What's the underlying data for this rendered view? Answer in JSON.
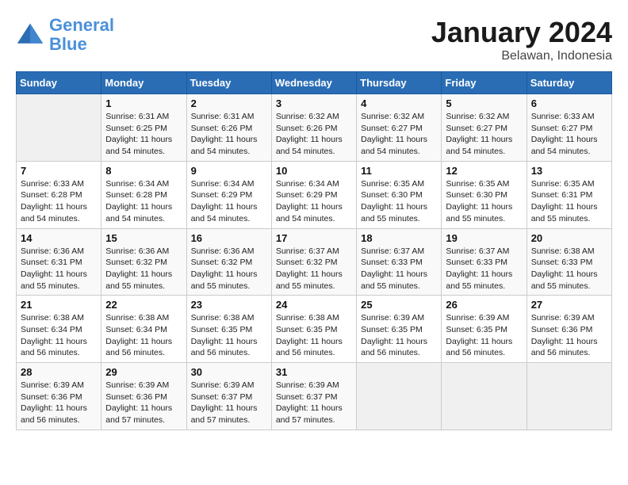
{
  "header": {
    "logo_line1": "General",
    "logo_line2": "Blue",
    "month": "January 2024",
    "location": "Belawan, Indonesia"
  },
  "days_of_week": [
    "Sunday",
    "Monday",
    "Tuesday",
    "Wednesday",
    "Thursday",
    "Friday",
    "Saturday"
  ],
  "weeks": [
    [
      {
        "day": "",
        "sunrise": "",
        "sunset": "",
        "daylight": ""
      },
      {
        "day": "1",
        "sunrise": "Sunrise: 6:31 AM",
        "sunset": "Sunset: 6:25 PM",
        "daylight": "Daylight: 11 hours and 54 minutes."
      },
      {
        "day": "2",
        "sunrise": "Sunrise: 6:31 AM",
        "sunset": "Sunset: 6:26 PM",
        "daylight": "Daylight: 11 hours and 54 minutes."
      },
      {
        "day": "3",
        "sunrise": "Sunrise: 6:32 AM",
        "sunset": "Sunset: 6:26 PM",
        "daylight": "Daylight: 11 hours and 54 minutes."
      },
      {
        "day": "4",
        "sunrise": "Sunrise: 6:32 AM",
        "sunset": "Sunset: 6:27 PM",
        "daylight": "Daylight: 11 hours and 54 minutes."
      },
      {
        "day": "5",
        "sunrise": "Sunrise: 6:32 AM",
        "sunset": "Sunset: 6:27 PM",
        "daylight": "Daylight: 11 hours and 54 minutes."
      },
      {
        "day": "6",
        "sunrise": "Sunrise: 6:33 AM",
        "sunset": "Sunset: 6:27 PM",
        "daylight": "Daylight: 11 hours and 54 minutes."
      }
    ],
    [
      {
        "day": "7",
        "sunrise": "Sunrise: 6:33 AM",
        "sunset": "Sunset: 6:28 PM",
        "daylight": "Daylight: 11 hours and 54 minutes."
      },
      {
        "day": "8",
        "sunrise": "Sunrise: 6:34 AM",
        "sunset": "Sunset: 6:28 PM",
        "daylight": "Daylight: 11 hours and 54 minutes."
      },
      {
        "day": "9",
        "sunrise": "Sunrise: 6:34 AM",
        "sunset": "Sunset: 6:29 PM",
        "daylight": "Daylight: 11 hours and 54 minutes."
      },
      {
        "day": "10",
        "sunrise": "Sunrise: 6:34 AM",
        "sunset": "Sunset: 6:29 PM",
        "daylight": "Daylight: 11 hours and 54 minutes."
      },
      {
        "day": "11",
        "sunrise": "Sunrise: 6:35 AM",
        "sunset": "Sunset: 6:30 PM",
        "daylight": "Daylight: 11 hours and 55 minutes."
      },
      {
        "day": "12",
        "sunrise": "Sunrise: 6:35 AM",
        "sunset": "Sunset: 6:30 PM",
        "daylight": "Daylight: 11 hours and 55 minutes."
      },
      {
        "day": "13",
        "sunrise": "Sunrise: 6:35 AM",
        "sunset": "Sunset: 6:31 PM",
        "daylight": "Daylight: 11 hours and 55 minutes."
      }
    ],
    [
      {
        "day": "14",
        "sunrise": "Sunrise: 6:36 AM",
        "sunset": "Sunset: 6:31 PM",
        "daylight": "Daylight: 11 hours and 55 minutes."
      },
      {
        "day": "15",
        "sunrise": "Sunrise: 6:36 AM",
        "sunset": "Sunset: 6:32 PM",
        "daylight": "Daylight: 11 hours and 55 minutes."
      },
      {
        "day": "16",
        "sunrise": "Sunrise: 6:36 AM",
        "sunset": "Sunset: 6:32 PM",
        "daylight": "Daylight: 11 hours and 55 minutes."
      },
      {
        "day": "17",
        "sunrise": "Sunrise: 6:37 AM",
        "sunset": "Sunset: 6:32 PM",
        "daylight": "Daylight: 11 hours and 55 minutes."
      },
      {
        "day": "18",
        "sunrise": "Sunrise: 6:37 AM",
        "sunset": "Sunset: 6:33 PM",
        "daylight": "Daylight: 11 hours and 55 minutes."
      },
      {
        "day": "19",
        "sunrise": "Sunrise: 6:37 AM",
        "sunset": "Sunset: 6:33 PM",
        "daylight": "Daylight: 11 hours and 55 minutes."
      },
      {
        "day": "20",
        "sunrise": "Sunrise: 6:38 AM",
        "sunset": "Sunset: 6:33 PM",
        "daylight": "Daylight: 11 hours and 55 minutes."
      }
    ],
    [
      {
        "day": "21",
        "sunrise": "Sunrise: 6:38 AM",
        "sunset": "Sunset: 6:34 PM",
        "daylight": "Daylight: 11 hours and 56 minutes."
      },
      {
        "day": "22",
        "sunrise": "Sunrise: 6:38 AM",
        "sunset": "Sunset: 6:34 PM",
        "daylight": "Daylight: 11 hours and 56 minutes."
      },
      {
        "day": "23",
        "sunrise": "Sunrise: 6:38 AM",
        "sunset": "Sunset: 6:35 PM",
        "daylight": "Daylight: 11 hours and 56 minutes."
      },
      {
        "day": "24",
        "sunrise": "Sunrise: 6:38 AM",
        "sunset": "Sunset: 6:35 PM",
        "daylight": "Daylight: 11 hours and 56 minutes."
      },
      {
        "day": "25",
        "sunrise": "Sunrise: 6:39 AM",
        "sunset": "Sunset: 6:35 PM",
        "daylight": "Daylight: 11 hours and 56 minutes."
      },
      {
        "day": "26",
        "sunrise": "Sunrise: 6:39 AM",
        "sunset": "Sunset: 6:35 PM",
        "daylight": "Daylight: 11 hours and 56 minutes."
      },
      {
        "day": "27",
        "sunrise": "Sunrise: 6:39 AM",
        "sunset": "Sunset: 6:36 PM",
        "daylight": "Daylight: 11 hours and 56 minutes."
      }
    ],
    [
      {
        "day": "28",
        "sunrise": "Sunrise: 6:39 AM",
        "sunset": "Sunset: 6:36 PM",
        "daylight": "Daylight: 11 hours and 56 minutes."
      },
      {
        "day": "29",
        "sunrise": "Sunrise: 6:39 AM",
        "sunset": "Sunset: 6:36 PM",
        "daylight": "Daylight: 11 hours and 57 minutes."
      },
      {
        "day": "30",
        "sunrise": "Sunrise: 6:39 AM",
        "sunset": "Sunset: 6:37 PM",
        "daylight": "Daylight: 11 hours and 57 minutes."
      },
      {
        "day": "31",
        "sunrise": "Sunrise: 6:39 AM",
        "sunset": "Sunset: 6:37 PM",
        "daylight": "Daylight: 11 hours and 57 minutes."
      },
      {
        "day": "",
        "sunrise": "",
        "sunset": "",
        "daylight": ""
      },
      {
        "day": "",
        "sunrise": "",
        "sunset": "",
        "daylight": ""
      },
      {
        "day": "",
        "sunrise": "",
        "sunset": "",
        "daylight": ""
      }
    ]
  ]
}
